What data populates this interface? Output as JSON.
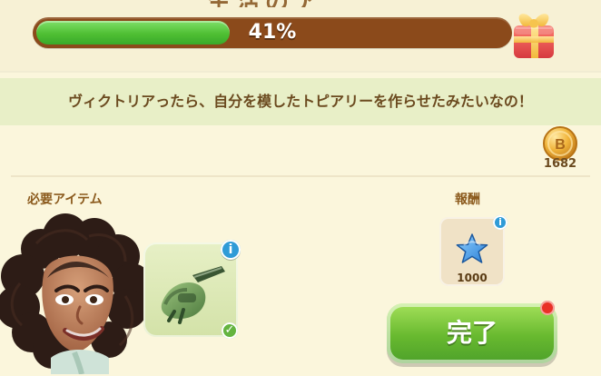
{
  "top": {
    "title_fragment": "生活のア"
  },
  "progress": {
    "value": 0.41,
    "label": "41%"
  },
  "quest": {
    "message": "ヴィクトリアったら、自分を模したトピアリーを作らせたみたいなの！"
  },
  "coins": {
    "count": "1682",
    "symbol": "B"
  },
  "sections": {
    "required_items_label": "必要アイテム",
    "reward_label": "報酬"
  },
  "icons": {
    "gift": "gift-icon",
    "coin": "coin-icon",
    "chainsaw": "chainsaw-icon",
    "reward": "blue-star-icon",
    "info": "info-icon",
    "check": "check-icon",
    "notification": "notification-dot-icon"
  },
  "reward": {
    "amount": "1000"
  },
  "info_glyph": "i",
  "check_glyph": "✓",
  "actions": {
    "complete_label": "完了"
  },
  "colors": {
    "background": "#f6f1d6",
    "message_band": "#e8efc7",
    "progress_track": "#8b4a1b",
    "progress_fill": "#4fbf33",
    "accent_text": "#8b5a1d",
    "button_green": "#68b92f",
    "info_blue": "#2f9bd7",
    "notification_red": "#e93126"
  }
}
